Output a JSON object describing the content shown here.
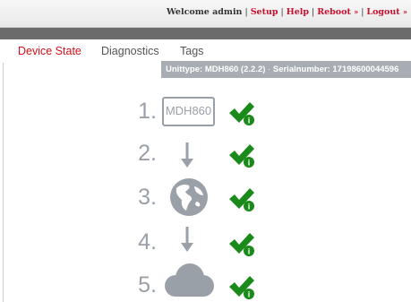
{
  "header": {
    "welcome_text": "Welcome admin",
    "links": [
      {
        "label": "Setup",
        "arrow": ""
      },
      {
        "label": "Help",
        "arrow": ""
      },
      {
        "label": "Reboot",
        "arrow": "»"
      },
      {
        "label": "Logout",
        "arrow": "»"
      }
    ]
  },
  "tabs": [
    "Device State",
    "Diagnostics",
    "Tags"
  ],
  "infobar": {
    "unittype_label": "Unittype:",
    "unittype_value": "MDH860 (2.2.2)",
    "separator": "·",
    "serial_label": "Serialnumber:",
    "serial_value": "17198600044596"
  },
  "steps": [
    {
      "number": "1.",
      "item": "MDH860",
      "icon": "device-box",
      "status": "ok"
    },
    {
      "number": "2.",
      "item": "",
      "icon": "arrow-down-icon",
      "status": "ok"
    },
    {
      "number": "3.",
      "item": "",
      "icon": "globe-icon",
      "status": "ok"
    },
    {
      "number": "4.",
      "item": "",
      "icon": "arrow-down-icon",
      "status": "ok"
    },
    {
      "number": "5.",
      "item": "",
      "icon": "cloud-icon",
      "status": "ok"
    }
  ],
  "colors": {
    "accent": "#d4101a",
    "icon_gray": "#9aa0a7",
    "check_green": "#1a8a1a",
    "infobar_bg": "#a8adb3"
  }
}
